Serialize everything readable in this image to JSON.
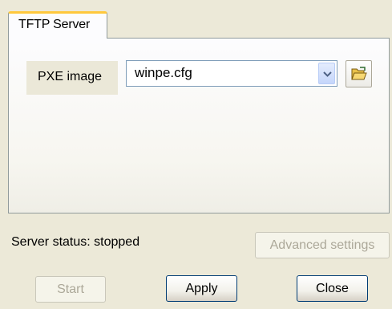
{
  "tabs": [
    {
      "label": "TFTP Server",
      "active": true
    }
  ],
  "pxe": {
    "label": "PXE image",
    "value": "winpe.cfg",
    "browse_icon": "open-folder-icon",
    "dropdown_icon": "chevron-down-icon"
  },
  "status": {
    "text": "Server status: stopped"
  },
  "buttons": {
    "advanced": "Advanced settings",
    "start": "Start",
    "apply": "Apply",
    "close": "Close"
  },
  "colors": {
    "window_bg": "#ece9d8",
    "tab_accent": "#ffc83c",
    "combo_border": "#7f9db9",
    "button_border": "#003c74",
    "disabled_text": "#aca899"
  }
}
